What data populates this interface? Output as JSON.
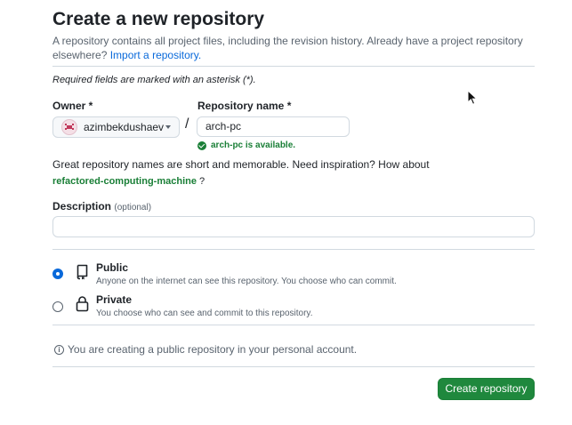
{
  "page": {
    "title": "Create a new repository",
    "intro_text": "A repository contains all project files, including the revision history. Already have a project repository elsewhere?",
    "import_link": "Import a repository."
  },
  "form": {
    "required_note": "Required fields are marked with an asterisk (*).",
    "owner": {
      "label": "Owner *",
      "value": "azimbekdushaev"
    },
    "separator": "/",
    "repo_name": {
      "label": "Repository name *",
      "value": "arch-pc",
      "availability": "arch-pc is available."
    },
    "hint_text": "Great repository names are short and memorable. Need inspiration? How about",
    "suggestion": "refactored-computing-machine",
    "suggestion_suffix": " ?",
    "description": {
      "label": "Description",
      "optional": "(optional)",
      "value": ""
    }
  },
  "visibility": {
    "selected": "public",
    "options": [
      {
        "id": "public",
        "label": "Public",
        "description": "Anyone on the internet can see this repository. You choose who can commit."
      },
      {
        "id": "private",
        "label": "Private",
        "description": "You choose who can see and commit to this repository."
      }
    ]
  },
  "notice": "You are creating a public repository in your personal account.",
  "actions": {
    "create_label": "Create repository"
  },
  "icons": {
    "info": "info-icon",
    "repo": "repo-icon",
    "lock": "lock-icon",
    "check": "check-circle-icon",
    "caret": "triangle-down-icon"
  },
  "colors": {
    "primary_button": "#1f883d",
    "link": "#0969da",
    "success": "#1a7f37",
    "radio_selected": "#0969da"
  }
}
